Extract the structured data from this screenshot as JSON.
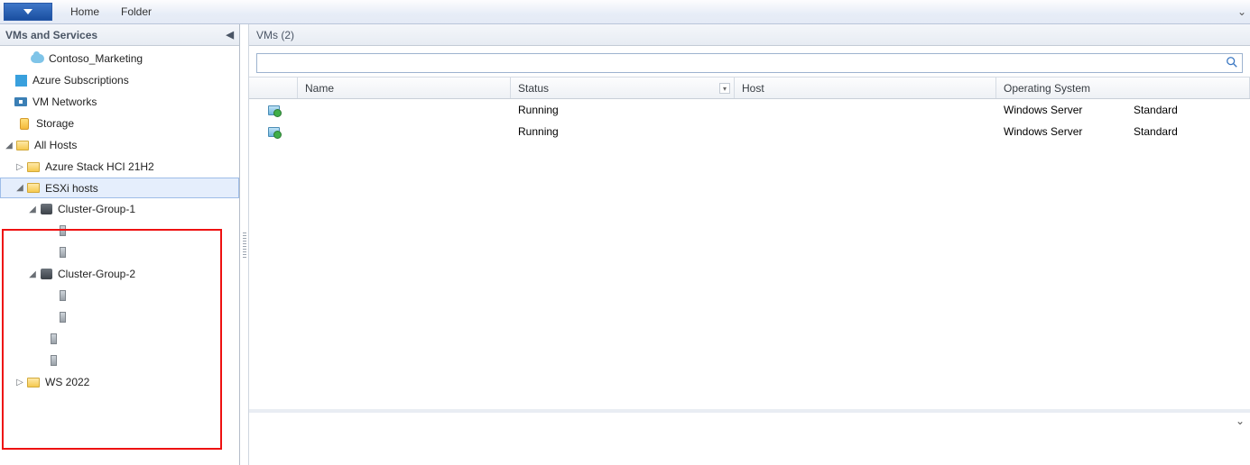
{
  "ribbon": {
    "tabs": [
      "Home",
      "Folder"
    ]
  },
  "sidebar": {
    "title": "VMs and Services",
    "items": {
      "marketing": "Contoso_Marketing",
      "azure_subs": "Azure Subscriptions",
      "vm_networks": "VM Networks",
      "storage": "Storage",
      "all_hosts": "All Hosts",
      "azure_stack": "Azure Stack HCI 21H2",
      "esxi": "ESXi hosts",
      "cg1": "Cluster-Group-1",
      "cg2": "Cluster-Group-2",
      "ws2022": "WS 2022"
    }
  },
  "main": {
    "header": "VMs (2)",
    "columns": {
      "name": "Name",
      "status": "Status",
      "host": "Host",
      "os": "Operating System"
    },
    "rows": [
      {
        "name": "",
        "status": "Running",
        "host": "",
        "os": "Windows Server",
        "edition": "Standard"
      },
      {
        "name": "",
        "status": "Running",
        "host": "",
        "os": "Windows Server",
        "edition": "Standard"
      }
    ]
  }
}
